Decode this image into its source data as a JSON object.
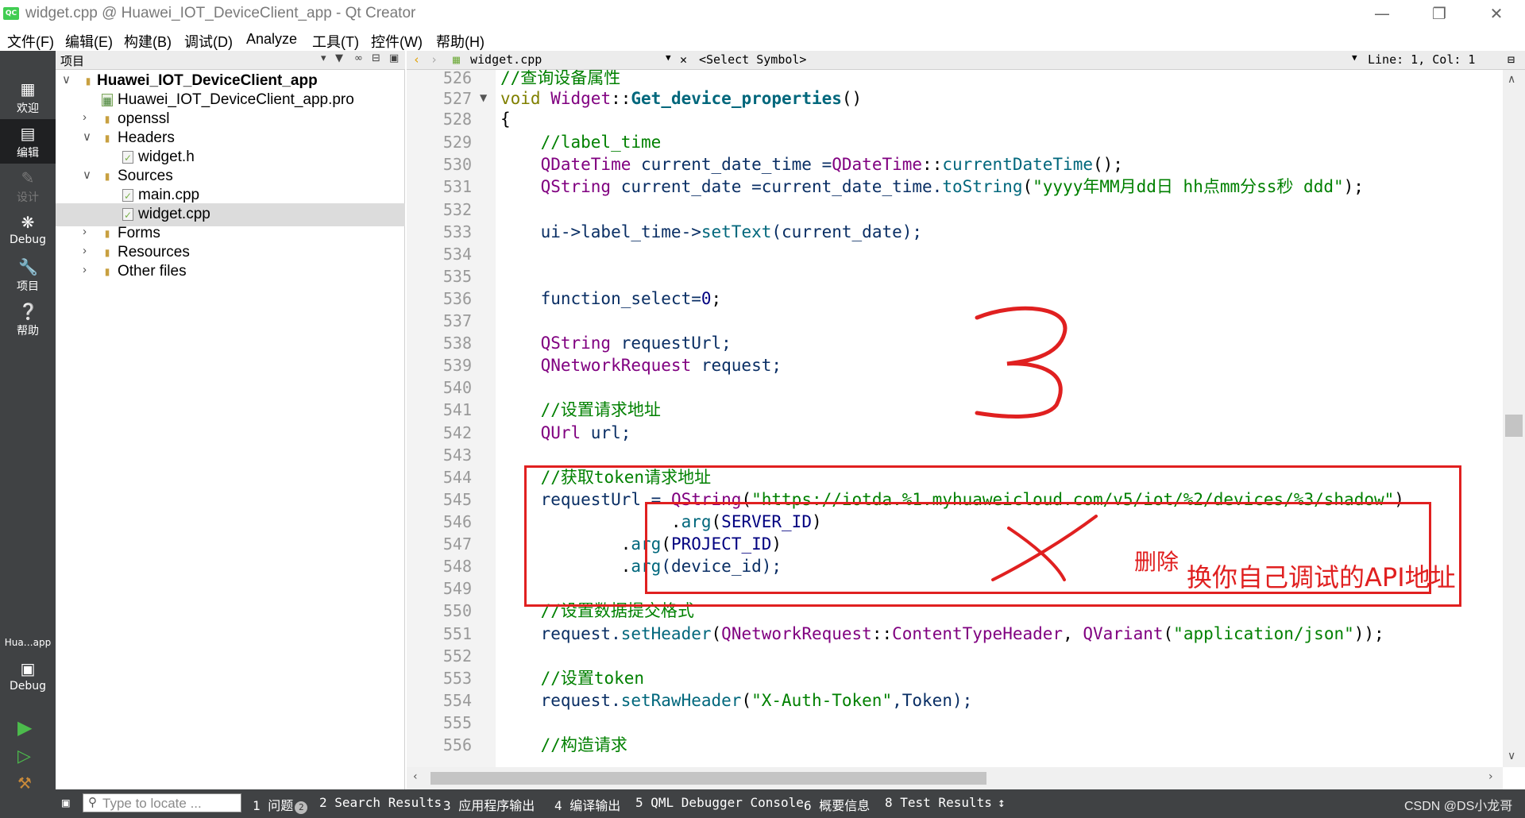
{
  "window": {
    "title": "widget.cpp @ Huawei_IOT_DeviceClient_app - Qt Creator",
    "logo_text": "QC"
  },
  "menu": [
    "文件(F)",
    "编辑(E)",
    "构建(B)",
    "调试(D)",
    "Analyze",
    "工具(T)",
    "控件(W)",
    "帮助(H)"
  ],
  "modes": {
    "welcome": "欢迎",
    "edit": "编辑",
    "design": "设计",
    "debug": "Debug",
    "projects": "项目",
    "help": "帮助",
    "kit_name": "Hua…app",
    "kit_config": "Debug"
  },
  "project_panel": {
    "title": "项目",
    "tree": [
      {
        "label": "Huawei_IOT_DeviceClient_app",
        "icon": "project-icon",
        "expanded": true
      },
      {
        "label": "Huawei_IOT_DeviceClient_app.pro",
        "icon": "pro-file-icon"
      },
      {
        "label": "openssl",
        "icon": "folder-icon",
        "expanded": false
      },
      {
        "label": "Headers",
        "icon": "folder-icon",
        "expanded": true
      },
      {
        "label": "widget.h",
        "icon": "header-file-icon"
      },
      {
        "label": "Sources",
        "icon": "folder-icon",
        "expanded": true
      },
      {
        "label": "main.cpp",
        "icon": "cpp-file-icon"
      },
      {
        "label": "widget.cpp",
        "icon": "cpp-file-icon",
        "selected": true
      },
      {
        "label": "Forms",
        "icon": "folder-icon",
        "expanded": false
      },
      {
        "label": "Resources",
        "icon": "folder-icon",
        "expanded": false
      },
      {
        "label": "Other files",
        "icon": "folder-icon",
        "expanded": false
      }
    ]
  },
  "editor_toolbar": {
    "file": "widget.cpp",
    "symbol": "<Select Symbol>",
    "position": "Line: 1, Col: 1"
  },
  "editor": {
    "line_numbers": [
      "526",
      "527",
      "528",
      "529",
      "530",
      "531",
      "532",
      "533",
      "534",
      "535",
      "536",
      "537",
      "538",
      "539",
      "540",
      "541",
      "542",
      "543",
      "544",
      "545",
      "546",
      "547",
      "548",
      "549",
      "550",
      "551",
      "552",
      "553",
      "554",
      "555",
      "556"
    ],
    "lines": {
      "l526": "//查询设备属性",
      "l527_kw": "void",
      "l527_cls": "Widget",
      "l527_sep": "::",
      "l527_fn": "Get_device_properties",
      "l527_par": "()",
      "l528": "{",
      "l529": "    //label_time",
      "l530_ty": "    QDateTime",
      "l530_var": " current_date_time =",
      "l530_ty2": "QDateTime",
      "l530_sep": "::",
      "l530_fn": "currentDateTime",
      "l530_end": "();",
      "l531_ty": "    QString",
      "l531_var": " current_date =current_date_time.",
      "l531_fn": "toString",
      "l531_p1": "(",
      "l531_st": "\"yyyy年MM月dd日 hh点mm分ss秒 ddd\"",
      "l531_end": ");",
      "l533_a": "    ui->label_time->",
      "l533_fn": "setText",
      "l533_b": "(current_date);",
      "l536_a": "    function_select=",
      "l536_nu": "0",
      "l536_b": ";",
      "l538_ty": "    QString",
      "l538_b": " requestUrl;",
      "l539_ty": "    QNetworkRequest",
      "l539_b": " request;",
      "l541": "    //设置请求地址",
      "l542_ty": "    QUrl",
      "l542_b": " url;",
      "l544": "    //获取token请求地址",
      "l545_a": "    requestUrl = ",
      "l545_ty": "QString",
      "l545_p": "(",
      "l545_st": "\"https://iotda.%1.myhuaweicloud.com/v5/iot/%2/devices/%3/shadow\"",
      "l545_end": ")",
      "l546_a": "                 .",
      "l546_fn": "arg",
      "l546_p": "(",
      "l546_m": "SERVER_ID",
      "l546_end": ")",
      "l547_a": "            .",
      "l547_fn": "arg",
      "l547_p": "(",
      "l547_m": "PROJECT_ID",
      "l547_end": ")",
      "l548_a": "            .",
      "l548_fn": "arg",
      "l548_b": "(device_id);",
      "l550": "    //设置数据提交格式",
      "l551_a": "    request.",
      "l551_fn": "setHeader",
      "l551_p": "(",
      "l551_ty": "QNetworkRequest",
      "l551_sep": "::",
      "l551_en": "ContentTypeHeader",
      "l551_c": ", ",
      "l551_ty2": "QVariant",
      "l551_p2": "(",
      "l551_st": "\"application/json\"",
      "l551_end": "));",
      "l553": "    //设置token",
      "l554_a": "    request.",
      "l554_fn": "setRawHeader",
      "l554_p": "(",
      "l554_st": "\"X-Auth-Token\"",
      "l554_b": ",Token);",
      "l556": "    //构造请求"
    }
  },
  "statusbar": {
    "locator_placeholder": "Type to locate ...",
    "panes": [
      "1 问题",
      "2 Search Results",
      "3 应用程序输出",
      "4 编译输出",
      "5 QML Debugger Console",
      "6 概要信息",
      "8 Test Results"
    ],
    "issues_badge": "2"
  },
  "annotations": {
    "delete_label": "删除",
    "replace_label": "换你自己调试的API地址",
    "watermark": "CSDN @DS小龙哥"
  },
  "colors": {
    "annotation_red": "#e02020",
    "comment_green": "#008000",
    "type_purple": "#800080",
    "function_teal": "#00677c",
    "keyword_olive": "#808000"
  }
}
